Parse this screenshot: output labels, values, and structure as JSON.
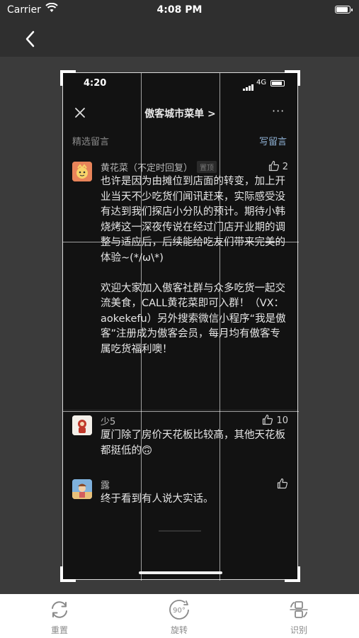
{
  "status_bar": {
    "carrier": "Carrier",
    "time": "4:08 PM"
  },
  "nav": {
    "back_icon": "chevron-left-icon"
  },
  "photo": {
    "status": {
      "time": "4:20",
      "network": "4G"
    },
    "header": {
      "title": "傲客城市菜单 >",
      "more": "···"
    },
    "section": {
      "label": "精选留言",
      "action": "写留言"
    },
    "comments": [
      {
        "name": "黄花菜（不定时回复）",
        "badge": "置顶",
        "likes": "2",
        "text": "也许是因为由摊位到店面的转变，加上开业当天不少吃货们闻讯赶来，实际感受没有达到我们探店小分队的预计。期待小韩烧烤这一深夜传说在经过门店开业期的调整与适应后，后续能给吃友们带来完美的体验~(*/ω\\*)\n\n欢迎大家加入傲客社群与众多吃货一起交流美食，CALL黄花菜即可入群！（VX：aokekefu）另外搜索微信小程序“我是傲客”注册成为傲客会员，每月均有傲客专属吃货福利噢！"
      },
      {
        "name": "少5",
        "likes": "10",
        "text": "厦门除了房价天花板比较高，其他天花板都挺低的🙃"
      },
      {
        "name": "露",
        "likes": "",
        "text": "终于看到有人说大实话。"
      }
    ]
  },
  "toolbar": {
    "reset_label": "重置",
    "rotate_label": "旋转",
    "rotate_badge": "90°",
    "recognize_label": "识别"
  },
  "colors": {
    "background": "#3b3b3b",
    "photo_bg": "#121212",
    "link_blue": "#8fb1d4",
    "toolbar_text": "#8a8a8a"
  }
}
